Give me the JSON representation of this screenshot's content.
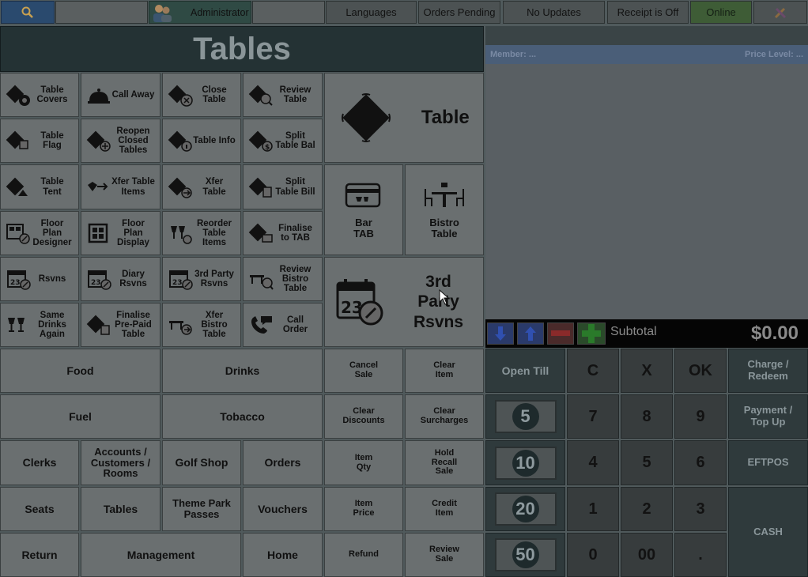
{
  "topbar": {
    "user": "Administrator",
    "languages": "Languages",
    "orders_pending": "Orders Pending",
    "no_updates": "No Updates",
    "receipt": "Receipt is Off",
    "online": "Online"
  },
  "header": {
    "title": "Tables"
  },
  "grid": {
    "table_covers": "Table Covers",
    "call_away": "Call Away",
    "close_table": "Close Table",
    "review_table": "Review Table",
    "table_flag": "Table Flag",
    "reopen_closed_tables": "Reopen Closed Tables",
    "table_info": "Table Info",
    "split_table_bal": "Split Table Bal",
    "table_tent": "Table Tent",
    "xfer_table_items": "Xfer Table Items",
    "xfer_table": "Xfer Table",
    "split_table_bill": "Split Table Bill",
    "floor_plan_designer": "Floor Plan Designer",
    "floor_plan_display": "Floor Plan Display",
    "reorder_table_items": "Reorder Table Items",
    "finalise_to_tab": "Finalise to TAB",
    "rsvns": "Rsvns",
    "diary_rsvns": "Diary Rsvns",
    "third_party_rsvns_small": "3rd Party Rsvns",
    "review_bistro_table": "Review Bistro Table",
    "same_drinks_again": "Same Drinks Again",
    "finalise_prepaid_table": "Finalise Pre-Paid Table",
    "xfer_bistro_table": "Xfer Bistro Table",
    "call_order": "Call Order",
    "table_big": "Table",
    "bar_tab": "Bar TAB",
    "bistro_table": "Bistro Table",
    "third_party_rsvns_big": "3rd Party Rsvns"
  },
  "categories": {
    "food": "Food",
    "drinks": "Drinks",
    "fuel": "Fuel",
    "tobacco": "Tobacco",
    "clerks": "Clerks",
    "accounts": "Accounts / Customers / Rooms",
    "golf_shop": "Golf Shop",
    "orders": "Orders",
    "seats": "Seats",
    "tables": "Tables",
    "theme_park": "Theme Park Passes",
    "vouchers": "Vouchers",
    "return": "Return",
    "management": "Management",
    "home": "Home"
  },
  "actions": {
    "cancel_sale": "Cancel Sale",
    "clear_item": "Clear Item",
    "clear_discounts": "Clear Discounts",
    "clear_surcharges": "Clear Surcharges",
    "item_qty": "Item Qty",
    "hold_recall_sale": "Hold Recall Sale",
    "item_price": "Item Price",
    "credit_item": "Credit Item",
    "refund": "Refund",
    "review_sale": "Review Sale"
  },
  "order_panel": {
    "member": "Member: ...",
    "price_level": "Price Level: ...",
    "subtotal_label": "Subtotal",
    "subtotal_value": "$0.00"
  },
  "keypad": {
    "open_till": "Open Till",
    "c": "C",
    "x": "X",
    "ok": "OK",
    "k7": "7",
    "k8": "8",
    "k9": "9",
    "k4": "4",
    "k5": "5",
    "k6": "6",
    "k1": "1",
    "k2": "2",
    "k3": "3",
    "k0": "0",
    "k00": "00",
    "dot": ".",
    "note5": "5",
    "note10": "10",
    "note20": "20",
    "note50": "50",
    "charge_redeem": "Charge / Redeem",
    "payment_topup": "Payment / Top Up",
    "eftpos": "EFTPOS",
    "cash": "CASH"
  }
}
